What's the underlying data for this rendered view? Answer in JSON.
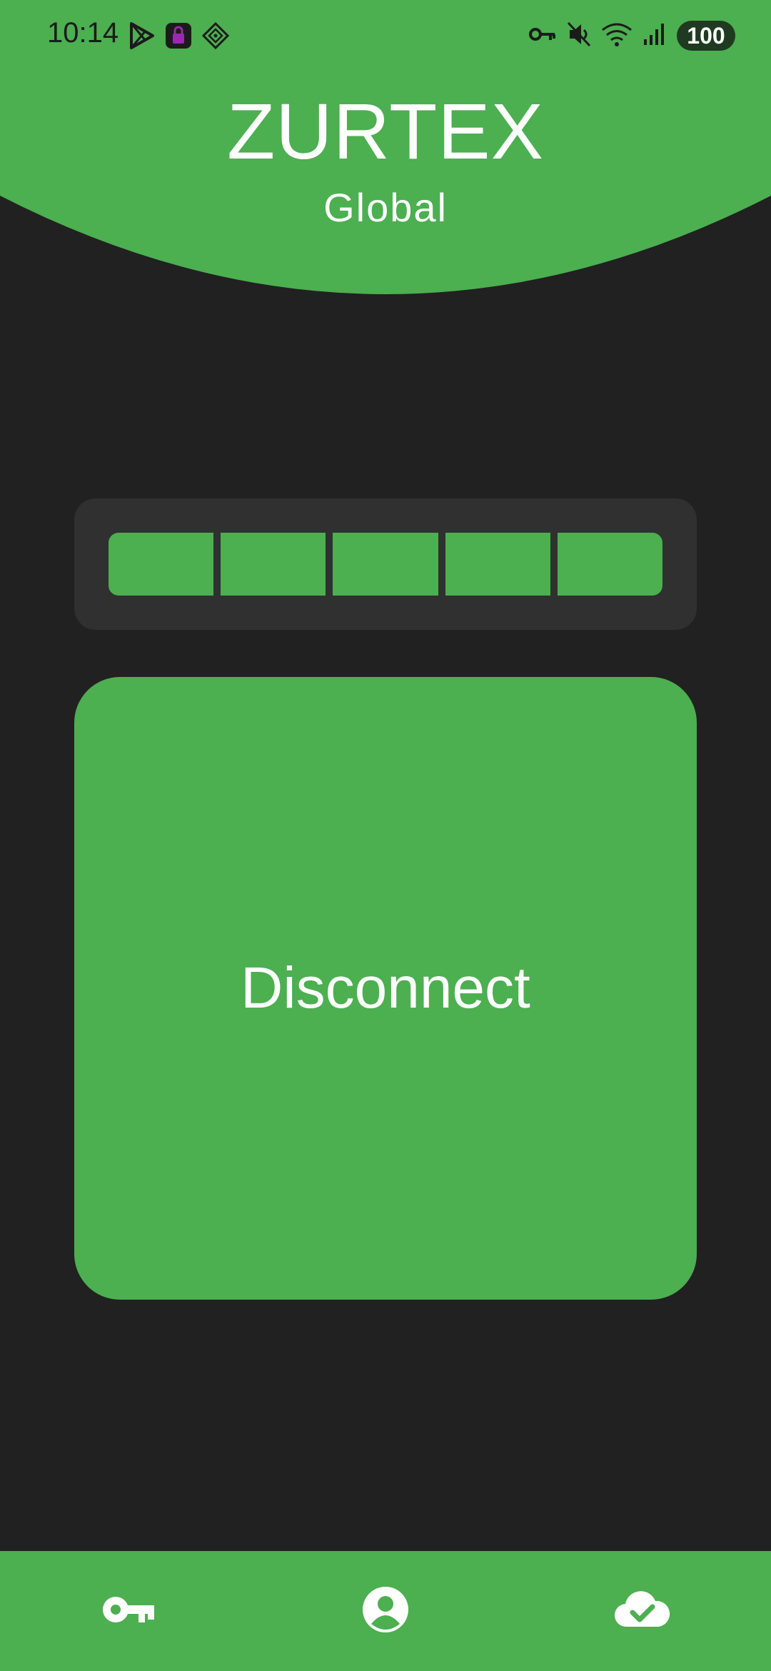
{
  "status_bar": {
    "time": "10:14",
    "battery": "100",
    "left_icons": [
      "play-store-icon",
      "vpn-lock-app-icon",
      "diamond-app-icon"
    ],
    "right_icons": [
      "vpn-key-icon",
      "mute-icon",
      "wifi-icon",
      "signal-icon"
    ]
  },
  "header": {
    "title": "ZURTEX",
    "subtitle": "Global"
  },
  "connection_strength": {
    "segments_filled": 5,
    "segments_total": 5
  },
  "main": {
    "disconnect_label": "Disconnect"
  },
  "bottom_nav": {
    "items": [
      {
        "icon": "key-icon"
      },
      {
        "icon": "account-circle-icon"
      },
      {
        "icon": "cloud-done-icon"
      }
    ]
  },
  "colors": {
    "accent": "#4caf50",
    "background": "#212121",
    "panel": "#303030",
    "text": "#ffffff"
  }
}
